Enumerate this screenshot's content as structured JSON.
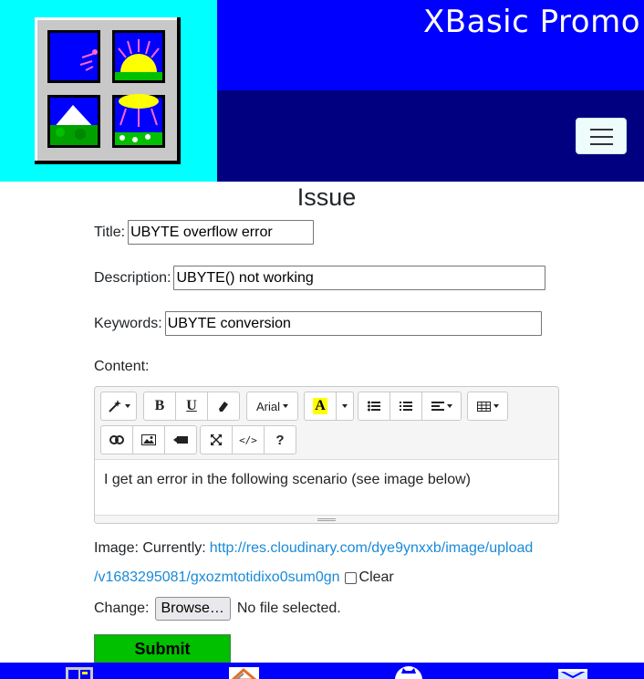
{
  "header": {
    "site_title": "XBasic Promo",
    "logo_name": "xbasic-windows-logo",
    "colors": {
      "logo_bg": "#00ffff",
      "top_bar": "#0000ff",
      "nav_bar": "#000080"
    }
  },
  "form": {
    "heading": "Issue",
    "title_label": "Title:",
    "title_value": "UBYTE overflow error",
    "description_label": "Description:",
    "description_value": "UBYTE() not working",
    "keywords_label": "Keywords:",
    "keywords_value": "UBYTE conversion",
    "content_label": "Content:",
    "image_label": "Image: Currently:",
    "image_url_line1": "http://res.cloudinary.com/dye9ynxxb/image/upload",
    "image_url_line2": "/v1683295081/gxozmtotidixo0sum0gn",
    "clear_label": "Clear",
    "change_label": "Change:",
    "browse_label": "Browse…",
    "no_file_label": "No file selected.",
    "submit_label": "Submit"
  },
  "editor": {
    "font_label": "Arial",
    "bold_glyph": "B",
    "underline_glyph": "U",
    "help_glyph": "?",
    "code_glyph": "</>",
    "highlight_glyph": "A",
    "content_text": "I get an error in the following scenario (see image below)"
  },
  "colors": {
    "submit_bg": "#00c000",
    "footer_bg": "#0000ff",
    "link": "#1a8ad8"
  }
}
